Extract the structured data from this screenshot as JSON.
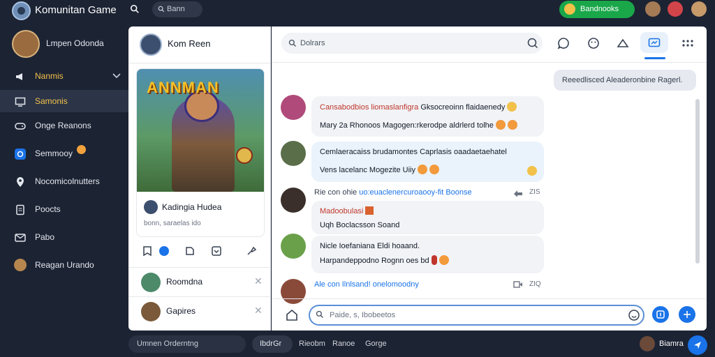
{
  "app": {
    "title": "Komunitan Game",
    "top_search": "Bann",
    "promo": "Bandnooks"
  },
  "sidebar": {
    "profile_name": "Lmpen Odonda",
    "items": [
      {
        "label": "Nanmis",
        "icon": "megaphone-icon"
      },
      {
        "label": "Samonis",
        "icon": "monitor-icon"
      },
      {
        "label": "Onge Reanons",
        "icon": "controller-icon"
      },
      {
        "label": "Semmooy",
        "icon": "chat-icon"
      },
      {
        "label": "Nocomicolnutters",
        "icon": "location-icon"
      },
      {
        "label": "Poocts",
        "icon": "document-icon"
      },
      {
        "label": "Pabo",
        "icon": "mail-icon"
      },
      {
        "label": "Reagan Urando",
        "icon": "avatar-icon"
      }
    ]
  },
  "left_panel": {
    "header_name": "Kom Reen",
    "card": {
      "banner": "ANNMAN",
      "title": "Kadingia Hudea",
      "subtitle": "bonn, saraelas ido"
    },
    "friends": [
      {
        "name": "Roomdna"
      },
      {
        "name": "Gapires"
      }
    ]
  },
  "main": {
    "search_placeholder": "Dolrars",
    "top_right_message": "Reeedlisced Aleaderonbine Ragerl.",
    "messages": [
      {
        "line1_red": "Cansabodbios liomaslanfigra",
        "line1_rest": "Gksocreoinn flaidaenedy",
        "line2": "Mary 2a Rhonoos Magogen:rkerodpe aldrlerd tolhe"
      },
      {
        "line1": "Cemlaeracaiss brudamontes Caprlasis oaadaetaehatel",
        "line2": "Vens lacelanc Mogezite Uiiy"
      },
      {
        "sys_prefix": "Rie con ohie",
        "sys_link": "uo:euaclenercuroaooy-fit Boonse",
        "meta": "ZIS",
        "title": "Madoobulasi",
        "line2": "Uqh Boclacsson Soand"
      },
      {
        "line1": "Nicle Ioefaniana Eldi hoaand.",
        "line2": "Harpandeppodno Rognn oes bd"
      },
      {
        "sys_link": "Ale con Ilnlsand! onelomoodny",
        "meta": "ZIQ"
      }
    ],
    "composer_placeholder": "Paide, s, Ibobeetos"
  },
  "bottom_bar": {
    "input": "Umnen Orderntng",
    "chip": "IbdrGr",
    "links": [
      "Rieobm",
      "Ranoe",
      "Gorge"
    ],
    "user": "Biamra"
  }
}
